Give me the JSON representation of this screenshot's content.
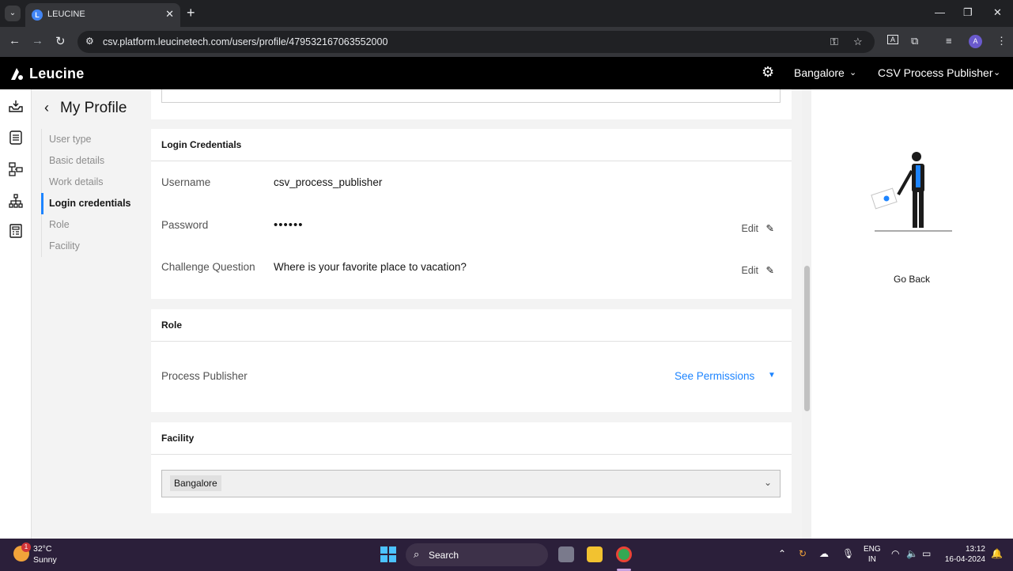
{
  "browser": {
    "tab_title": "LEUCINE",
    "tab_close": "✕",
    "new_tab": "+",
    "url": "csv.platform.leucinetech.com/users/profile/479532167063552000",
    "profile_initial": "A",
    "ext_letter": "A"
  },
  "app": {
    "logo_text": "Leucine",
    "facility": "Bangalore",
    "user_role": "CSV Process Publisher"
  },
  "profile": {
    "title": "My Profile",
    "nav": [
      {
        "label": "User type",
        "active": false
      },
      {
        "label": "Basic details",
        "active": false
      },
      {
        "label": "Work details",
        "active": false
      },
      {
        "label": "Login credentials",
        "active": true
      },
      {
        "label": "Role",
        "active": false
      },
      {
        "label": "Facility",
        "active": false
      }
    ]
  },
  "login": {
    "heading": "Login Credentials",
    "username_label": "Username",
    "username_value": "csv_process_publisher",
    "password_label": "Password",
    "password_value": "••••••",
    "password_edit": "Edit",
    "question_label": "Challenge Question",
    "question_value": "Where is your favorite place to vacation?",
    "question_edit": "Edit"
  },
  "role": {
    "heading": "Role",
    "name": "Process Publisher",
    "see_permissions": "See Permissions"
  },
  "facility_card": {
    "heading": "Facility",
    "selected": "Bangalore"
  },
  "right_panel": {
    "go_back": "Go Back"
  },
  "taskbar": {
    "weather_badge": "1",
    "temp": "32°C",
    "condition": "Sunny",
    "search_label": "Search",
    "lang_top": "ENG",
    "lang_bottom": "IN",
    "time": "13:12",
    "date": "16-04-2024"
  },
  "colors": {
    "accent": "#1d84ff",
    "header_bg": "#000000"
  }
}
